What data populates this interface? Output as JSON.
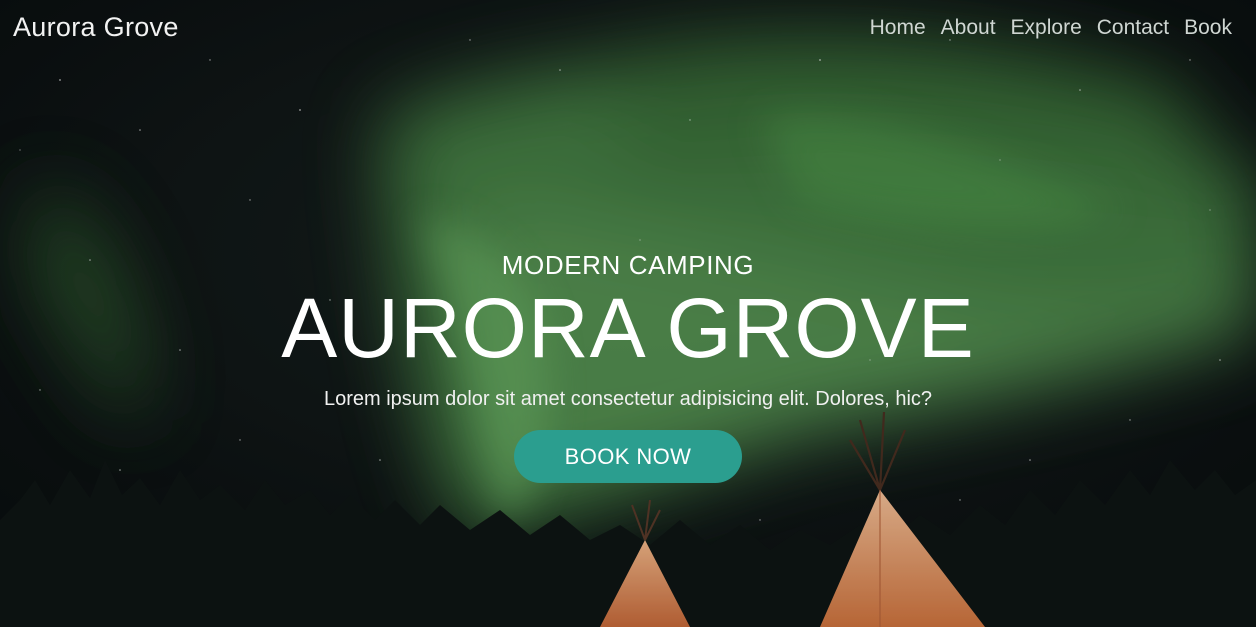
{
  "header": {
    "brand": "Aurora Grove",
    "nav": [
      {
        "label": "Home"
      },
      {
        "label": "About"
      },
      {
        "label": "Explore"
      },
      {
        "label": "Contact"
      },
      {
        "label": "Book"
      }
    ]
  },
  "hero": {
    "eyebrow": "MODERN CAMPING",
    "title": "AURORA GROVE",
    "tagline": "Lorem ipsum dolor sit amet consectetur adipisicing elit. Dolores, hic?",
    "cta_label": "BOOK NOW",
    "background": "northern-lights-over-teepees-image"
  },
  "colors": {
    "accent": "#2b9e8f",
    "aurora": "#5fa35a",
    "night_sky": "#0b1114",
    "teepee_glow": "#e79a62"
  }
}
